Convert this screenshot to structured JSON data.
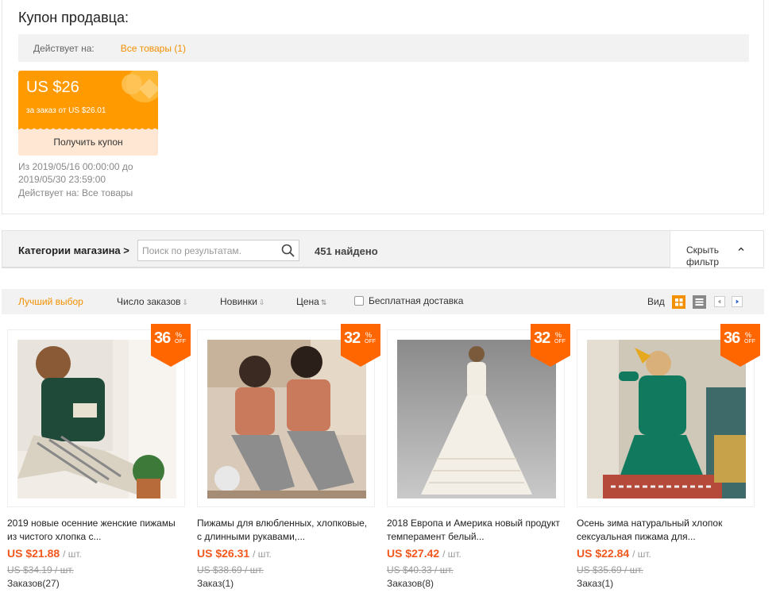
{
  "coupon": {
    "title": "Купон продавца:",
    "applies_label": "Действует на:",
    "applies_link": "Все товары (1)",
    "amount": "US $26",
    "condition": "за заказ от US $26.01",
    "get_button": "Получить купон",
    "date_from": "Из 2019/05/16 00:00:00 до",
    "date_to": "2019/05/30 23:59:00",
    "applies_all": "Действует на: Все товары",
    "color": "#ff9a00"
  },
  "search": {
    "store_categories": "Категории магазина >",
    "placeholder": "Поиск по результатам.",
    "found": "451 найдено",
    "hide_filter": "Скрыть фильтр"
  },
  "sort": {
    "best": "Лучший выбор",
    "orders": "Число заказов",
    "new": "Новинки",
    "price": "Цена",
    "free_shipping": "Бесплатная доставка",
    "view": "Вид"
  },
  "products": [
    {
      "discount": "36",
      "pct": "%",
      "off": "OFF",
      "title": "2019 новые осенние женские пижамы из чистого хлопка с...",
      "price": "US $21.88",
      "unit": "/ шт.",
      "old_price": "US $34.19 / шт.",
      "orders": "Заказов(27)"
    },
    {
      "discount": "32",
      "pct": "%",
      "off": "OFF",
      "title": "Пижамы для влюбленных, хлопковые, с длинными рукавами,...",
      "price": "US $26.31",
      "unit": "/ шт.",
      "old_price": "US $38.69 / шт.",
      "orders": "Заказ(1)"
    },
    {
      "discount": "32",
      "pct": "%",
      "off": "OFF",
      "title": "2018 Европа и Америка новый продукт темперамент белый...",
      "price": "US $27.42",
      "unit": "/ шт.",
      "old_price": "US $40.33 / шт.",
      "orders": "Заказов(8)"
    },
    {
      "discount": "36",
      "pct": "%",
      "off": "OFF",
      "title": "Осень зима натуральный хлопок сексуальная пижама для...",
      "price": "US $22.84",
      "unit": "/ шт.",
      "old_price": "US $35.69 / шт.",
      "orders": "Заказ(1)"
    }
  ],
  "colors": {
    "accent": "#f29000",
    "price": "#f2581d",
    "badge": "#ff6600"
  }
}
